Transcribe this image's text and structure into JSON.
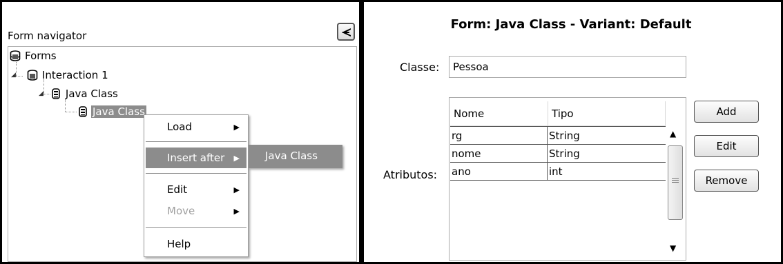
{
  "navigator": {
    "title": "Form navigator",
    "collapse_icon": "collapse-left-icon",
    "tree": {
      "root": "Forms",
      "child": "Interaction 1",
      "grandchild": "Java Class",
      "selected": "Java Class"
    }
  },
  "context_menu": {
    "items": {
      "load": "Load",
      "insert_after": "Insert after",
      "edit": "Edit",
      "move": "Move",
      "help": "Help"
    },
    "submenu_item": "Java Class"
  },
  "form": {
    "title": "Form: Java Class - Variant: Default",
    "classe_label": "Classe:",
    "classe_value": "Pessoa",
    "atributos_label": "Atributos:",
    "table": {
      "headers": [
        "Nome",
        "Tipo"
      ],
      "rows": [
        [
          "rg",
          "String"
        ],
        [
          "nome",
          "String"
        ],
        [
          "ano",
          "int"
        ]
      ]
    },
    "buttons": {
      "add": "Add",
      "edit": "Edit",
      "remove": "Remove"
    }
  },
  "colors": {
    "selection": "#8c8c8c",
    "divider": "#000000"
  }
}
